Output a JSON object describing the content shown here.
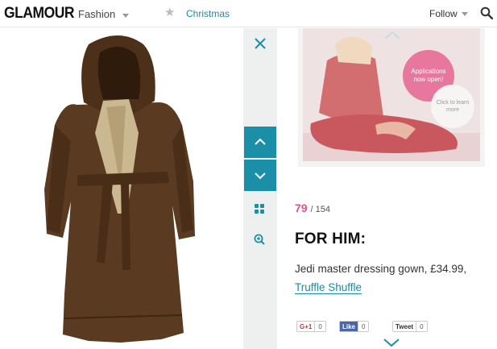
{
  "header": {
    "logo": "GLAMOUR",
    "section": "Fashion",
    "tag": "Christmas",
    "follow": "Follow"
  },
  "gallery": {
    "current": "79",
    "total": "/ 154"
  },
  "item": {
    "heading": "FOR HIM:",
    "description": "Jedi master dressing gown, £34.99,",
    "retailer_link": "Truffle Shuffle"
  },
  "ad": {
    "badge_primary": "Applications now open!",
    "badge_secondary": "Click to learn more"
  },
  "share": {
    "gplus_label": "G+1",
    "gplus_count": "0",
    "like_label": "Like",
    "like_count": "0",
    "tweet_label": "Tweet",
    "tweet_count": "0"
  },
  "colors": {
    "accent": "#1b8ea8",
    "counter_pink": "#e0508a",
    "ad_pink": "#e8779d"
  },
  "icons": [
    "star-icon",
    "search-icon",
    "close-icon",
    "chevron-up-icon",
    "chevron-down-icon",
    "grid-icon",
    "zoom-in-icon"
  ]
}
